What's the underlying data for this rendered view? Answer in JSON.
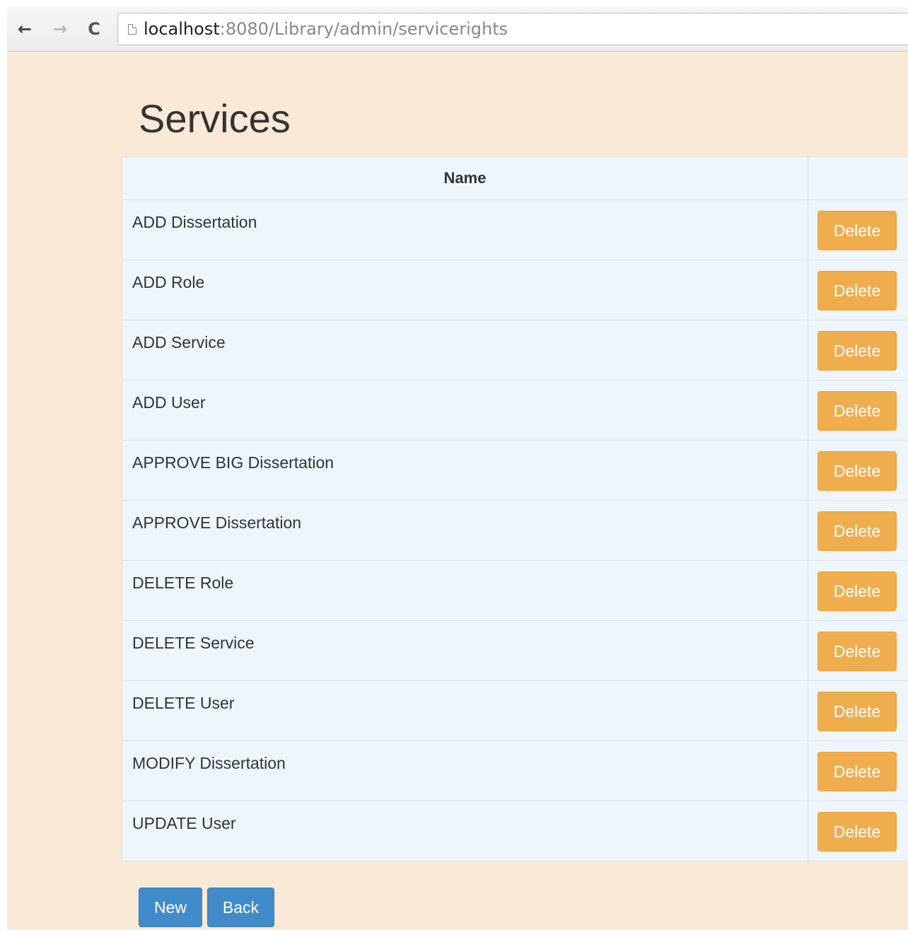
{
  "browser": {
    "url_host": "localhost",
    "url_rest": ":8080/Library/admin/servicerights",
    "back_glyph": "←",
    "forward_glyph": "→",
    "reload_glyph": "C"
  },
  "page": {
    "title": "Services",
    "table": {
      "header": {
        "name": "Name",
        "action": ""
      },
      "rows": [
        {
          "name": "ADD Dissertation",
          "action": "Delete"
        },
        {
          "name": "ADD Role",
          "action": "Delete"
        },
        {
          "name": "ADD Service",
          "action": "Delete"
        },
        {
          "name": "ADD User",
          "action": "Delete"
        },
        {
          "name": "APPROVE BIG Dissertation",
          "action": "Delete"
        },
        {
          "name": "APPROVE Dissertation",
          "action": "Delete"
        },
        {
          "name": "DELETE Role",
          "action": "Delete"
        },
        {
          "name": "DELETE Service",
          "action": "Delete"
        },
        {
          "name": "DELETE User",
          "action": "Delete"
        },
        {
          "name": "MODIFY Dissertation",
          "action": "Delete"
        },
        {
          "name": "UPDATE User",
          "action": "Delete"
        }
      ]
    },
    "buttons": {
      "new_label": "New",
      "back_label": "Back"
    }
  },
  "colors": {
    "page_background": "#f9e9d6",
    "table_background": "#eef6fc",
    "delete_button": "#f0ad4e",
    "primary_button": "#428bca"
  }
}
